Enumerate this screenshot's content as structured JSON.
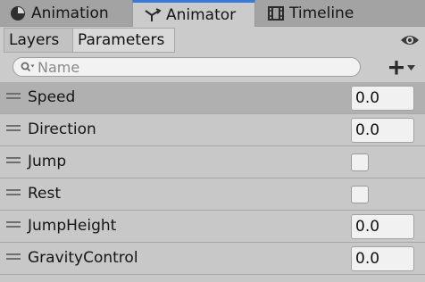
{
  "window_tabs": [
    {
      "label": "Animation",
      "icon": "clock-icon"
    },
    {
      "label": "Animator",
      "icon": "animator-graph-icon",
      "active": true
    },
    {
      "label": "Timeline",
      "icon": "filmstrip-icon"
    }
  ],
  "subtabs": {
    "layers": "Layers",
    "parameters": "Parameters",
    "active": "Parameters"
  },
  "search": {
    "placeholder": "Name",
    "value": ""
  },
  "add_button": {
    "icon": "plus-icon",
    "dropdown_icon": "triangle-down-icon"
  },
  "visibility_icon": "eye-icon",
  "parameters": [
    {
      "name": "Speed",
      "type": "float",
      "value": "0.0",
      "selected": true
    },
    {
      "name": "Direction",
      "type": "float",
      "value": "0.0"
    },
    {
      "name": "Jump",
      "type": "trigger",
      "value": false
    },
    {
      "name": "Rest",
      "type": "trigger",
      "value": false
    },
    {
      "name": "JumpHeight",
      "type": "float",
      "value": "0.0"
    },
    {
      "name": "GravityControl",
      "type": "float",
      "value": "0.0"
    }
  ],
  "colors": {
    "accent": "#3a79d8",
    "panel": "#c8c8c8",
    "selected_row": "#b0b0b0"
  }
}
